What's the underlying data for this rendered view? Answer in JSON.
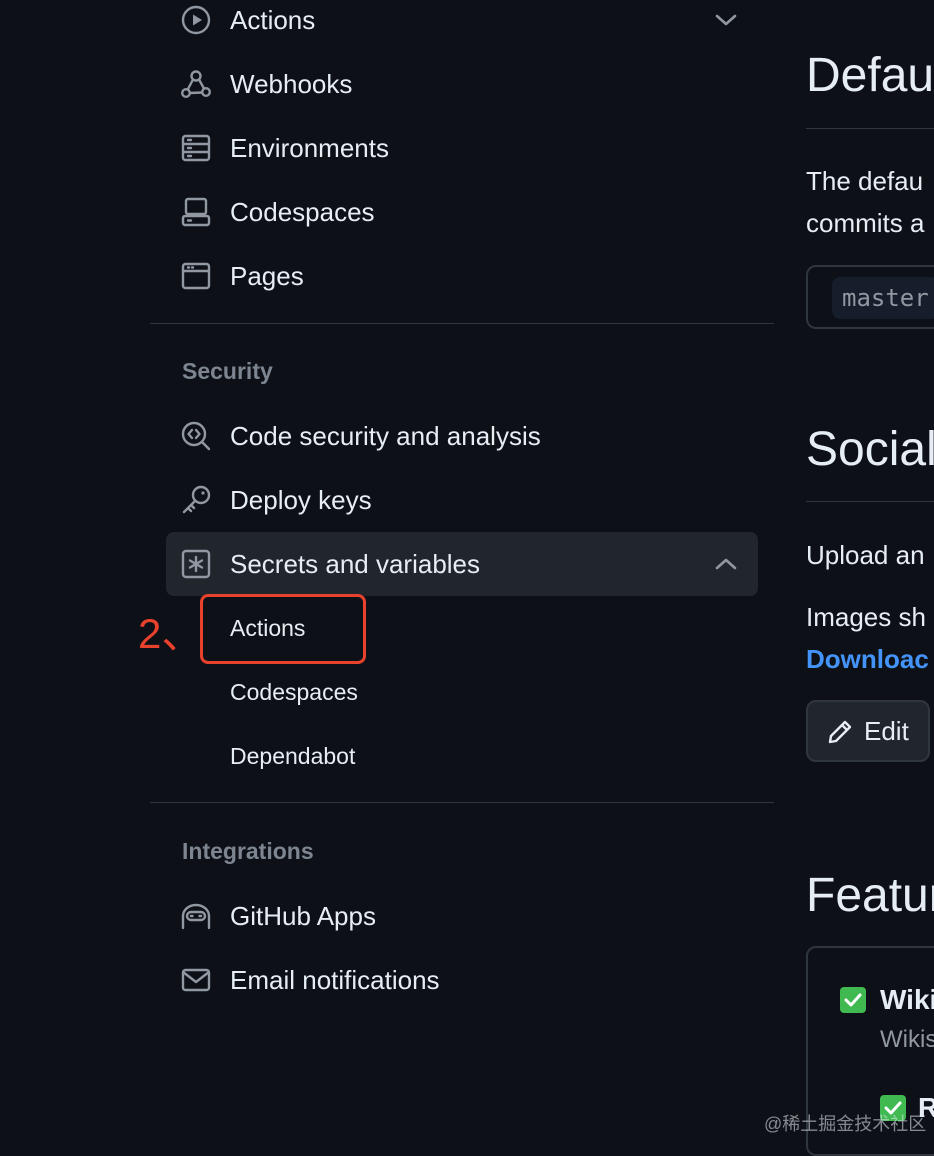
{
  "sidebar": {
    "top_items": [
      {
        "label": "Actions",
        "icon": "play-circle-icon"
      },
      {
        "label": "Webhooks",
        "icon": "webhook-icon"
      },
      {
        "label": "Environments",
        "icon": "server-icon"
      },
      {
        "label": "Codespaces",
        "icon": "codespaces-icon"
      },
      {
        "label": "Pages",
        "icon": "browser-icon"
      }
    ],
    "security": {
      "heading": "Security",
      "items": [
        {
          "label": "Code security and analysis",
          "icon": "codescan-icon"
        },
        {
          "label": "Deploy keys",
          "icon": "key-icon"
        },
        {
          "label": "Secrets and variables",
          "icon": "key-asterisk-icon"
        }
      ],
      "sub_items": [
        "Actions",
        "Codespaces",
        "Dependabot"
      ]
    },
    "integrations": {
      "heading": "Integrations",
      "items": [
        {
          "label": "GitHub Apps",
          "icon": "hubot-icon"
        },
        {
          "label": "Email notifications",
          "icon": "mail-icon"
        }
      ]
    }
  },
  "annotation": {
    "step_label": "2、",
    "color": "#e8412c"
  },
  "main": {
    "default_branch": {
      "heading": "Defaul",
      "line1": "The defau",
      "line2": "commits a",
      "branch": "master"
    },
    "social": {
      "heading": "Social",
      "line1": "Upload an",
      "line2": "Images sh",
      "link": "Downloac",
      "edit_label": "Edit"
    },
    "features": {
      "heading": "Featur",
      "wiki_label": "Wiki",
      "wiki_desc": "Wikis",
      "second_label": "R"
    }
  },
  "watermark": "@稀土掘金技术社区",
  "colors": {
    "background": "#0d1117",
    "active_item": "#21262d",
    "border": "#30363d",
    "muted": "#7d8590",
    "link": "#4493f8",
    "checkbox": "#3fb950"
  }
}
